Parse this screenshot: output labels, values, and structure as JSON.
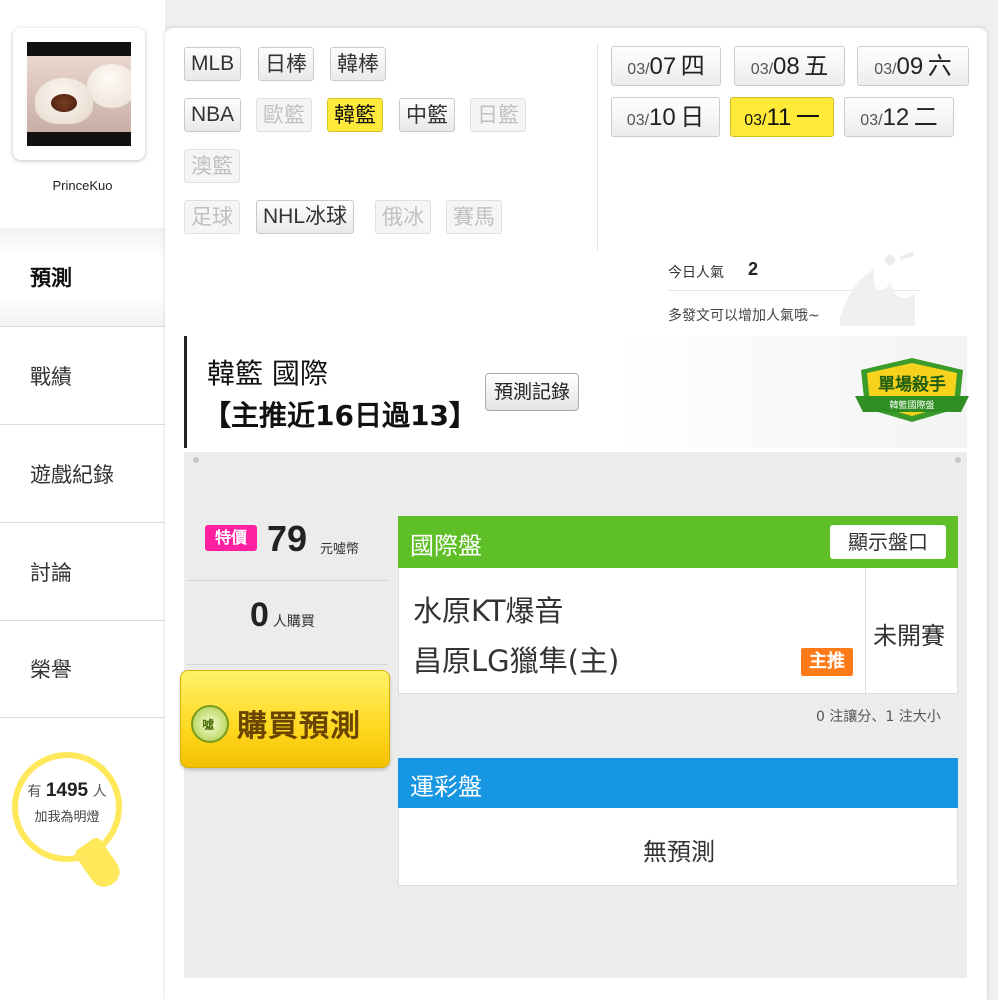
{
  "user": {
    "name": "PrinceKuo"
  },
  "nav": [
    {
      "label": "預測",
      "active": true
    },
    {
      "label": "戰績",
      "active": false
    },
    {
      "label": "遊戲紀錄",
      "active": false
    },
    {
      "label": "討論",
      "active": false
    },
    {
      "label": "榮譽",
      "active": false
    }
  ],
  "fans": {
    "prefix": "有",
    "count": "1495",
    "suffix": "人",
    "subtitle": "加我為明燈"
  },
  "leagues": [
    {
      "label": "MLB",
      "state": "normal"
    },
    {
      "label": "日棒",
      "state": "normal"
    },
    {
      "label": "韓棒",
      "state": "normal"
    },
    {
      "label": "NBA",
      "state": "normal"
    },
    {
      "label": "歐籃",
      "state": "disabled"
    },
    {
      "label": "韓籃",
      "state": "selected"
    },
    {
      "label": "中籃",
      "state": "normal"
    },
    {
      "label": "日籃",
      "state": "disabled"
    },
    {
      "label": "澳籃",
      "state": "disabled"
    },
    {
      "label": "足球",
      "state": "disabled"
    },
    {
      "label": "NHL冰球",
      "state": "normal"
    },
    {
      "label": "俄冰",
      "state": "disabled"
    },
    {
      "label": "賽馬",
      "state": "disabled"
    }
  ],
  "dates": [
    {
      "month": "03/",
      "day": "07",
      "weekday": "四",
      "selected": false
    },
    {
      "month": "03/",
      "day": "08",
      "weekday": "五",
      "selected": false
    },
    {
      "month": "03/",
      "day": "09",
      "weekday": "六",
      "selected": false
    },
    {
      "month": "03/",
      "day": "10",
      "weekday": "日",
      "selected": false
    },
    {
      "month": "03/",
      "day": "11",
      "weekday": "一",
      "selected": true
    },
    {
      "month": "03/",
      "day": "12",
      "weekday": "二",
      "selected": false
    }
  ],
  "popularity": {
    "label": "今日人氣",
    "value": "2",
    "hint": "多發文可以增加人氣哦~"
  },
  "prediction": {
    "title": "韓籃 國際",
    "subtitle": "【主推近16日過13】",
    "record_button": "預測記錄",
    "badge_title": "單場殺手",
    "badge_sub": "韓籃國際盤"
  },
  "purchase": {
    "tag": "特價",
    "price": "79",
    "unit": "元噓幣",
    "buyers": "0",
    "buyers_unit": "人購買",
    "button": "購買預測",
    "icon_text": "噓"
  },
  "international": {
    "title": "國際盤",
    "show_odds": "顯示盤口",
    "team_away": "水原KT爆音",
    "team_home": "昌原LG獵隼(主)",
    "main_pick": "主推",
    "status": "未開賽",
    "note": "0 注讓分、1 注大小"
  },
  "sports_lottery": {
    "title": "運彩盤",
    "empty": "無預測"
  },
  "colors": {
    "accent_yellow": "#ffea3a",
    "intl_green": "#5fbf26",
    "lottery_blue": "#1796e3",
    "promo_pink": "#ff1fa1",
    "pick_orange": "#ff7b1a"
  }
}
